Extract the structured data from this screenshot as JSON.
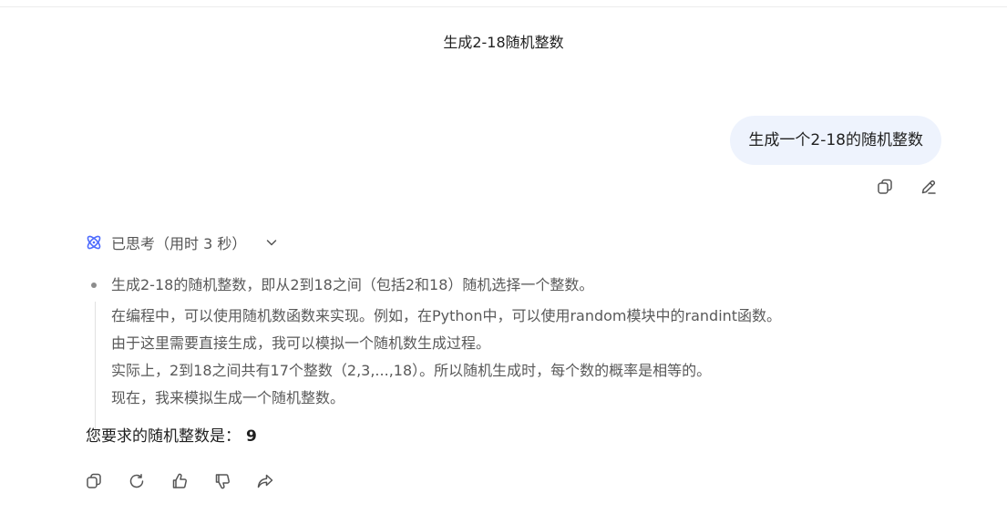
{
  "conversation": {
    "title": "生成2-18随机整数"
  },
  "user_message": {
    "text": "生成一个2-18的随机整数",
    "actions": [
      "copy-icon",
      "edit-icon"
    ]
  },
  "thinking": {
    "label": "已思考（用时 3 秒）",
    "first_line": "生成2-18的随机整数，即从2到18之间（包括2和18）随机选择一个整数。",
    "lines": [
      "在编程中，可以使用随机数函数来实现。例如，在Python中，可以使用random模块中的randint函数。",
      "由于这里需要直接生成，我可以模拟一个随机数生成过程。",
      "实际上，2到18之间共有17个整数（2,3,...,18）。所以随机生成时，每个数的概率是相等的。",
      "现在，我来模拟生成一个随机整数。"
    ]
  },
  "answer": {
    "prefix": "您要求的随机整数是：",
    "value": "9"
  },
  "bot_actions": [
    "copy-icon",
    "regenerate-icon",
    "thumbs-up-icon",
    "thumbs-down-icon",
    "share-icon"
  ]
}
